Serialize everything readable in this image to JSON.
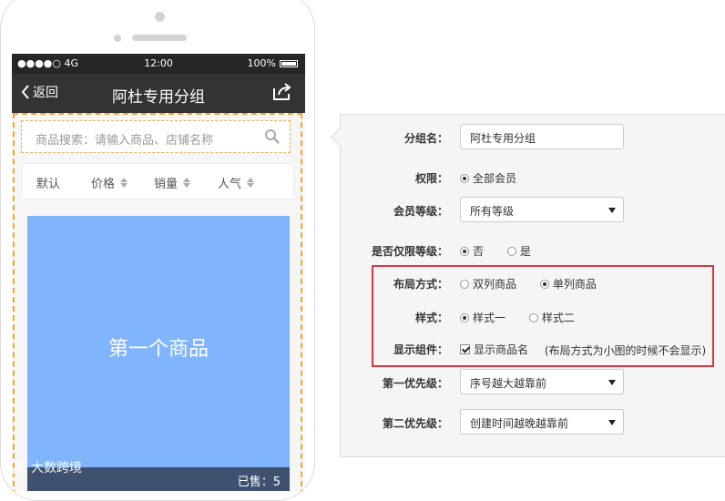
{
  "statusbar": {
    "signal": "●●●●○ 4G",
    "time": "12:00",
    "battery": "100%"
  },
  "navbar": {
    "back_label": "返回",
    "title": "阿杜专用分组"
  },
  "search": {
    "placeholder": "商品搜索：请输入商品、店铺名称"
  },
  "sort": {
    "items": [
      {
        "label": "默认"
      },
      {
        "label": "价格"
      },
      {
        "label": "销量"
      },
      {
        "label": "人气"
      }
    ]
  },
  "product": {
    "name": "第一个商品",
    "sold": "已售：5"
  },
  "watermark": {
    "text": "大数跨境"
  },
  "form": {
    "group_name": {
      "label": "分组名：",
      "value": "阿杜专用分组"
    },
    "permission": {
      "label": "权限：",
      "option": "全部会员"
    },
    "member_level": {
      "label": "会员等级：",
      "value": "所有等级"
    },
    "level_only": {
      "label": "是否仅限等级：",
      "options": [
        "否",
        "是"
      ]
    },
    "layout": {
      "label": "布局方式：",
      "options": [
        "双列商品",
        "单列商品"
      ]
    },
    "style": {
      "label": "样式：",
      "options": [
        "样式一",
        "样式二"
      ]
    },
    "component": {
      "label": "显示组件：",
      "checkbox": "显示商品名",
      "hint": "(布局方式为小图的时候不会显示)"
    },
    "priority1": {
      "label": "第一优先级：",
      "value": "序号越大越靠前"
    },
    "priority2": {
      "label": "第二优先级：",
      "value": "创建时间越晚越靠前"
    }
  },
  "colors": {
    "accent": "#f5a623",
    "product_bg": "#80b4fc",
    "highlight": "#d9363e",
    "navbar": "#333333"
  }
}
